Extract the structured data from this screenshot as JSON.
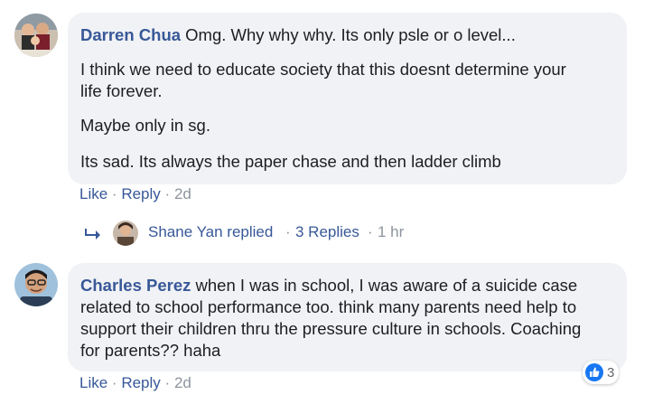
{
  "comments": [
    {
      "author": "Darren Chua",
      "first_line": "Omg. Why why why. Its only psle or o level...",
      "paragraphs": [
        "I think we need to educate society that this doesnt determine your",
        "life forever.",
        "Maybe only in sg.",
        "Its sad. Its always the paper chase and then ladder climb"
      ],
      "actions": {
        "like": "Like",
        "reply": "Reply",
        "time": "2d"
      },
      "replies_row": {
        "replier": "Shane Yan replied",
        "count": "3 Replies",
        "time": "1 hr"
      }
    },
    {
      "author": "Charles Perez",
      "lines": [
        "when I was in school, I was aware of a suicide case",
        "related to school performance too. think many parents need help to",
        "support their children thru the pressure culture in schools. Coaching",
        "for parents?? haha"
      ],
      "actions": {
        "like": "Like",
        "reply": "Reply",
        "time": "2d"
      },
      "reaction": {
        "icon": "thumbs-up-icon",
        "count": "3"
      }
    }
  ],
  "separator": "·",
  "colors": {
    "link": "#385898",
    "meta": "#8d949e",
    "bubble": "#f0f2f5",
    "like_blue": "#1877f2"
  }
}
